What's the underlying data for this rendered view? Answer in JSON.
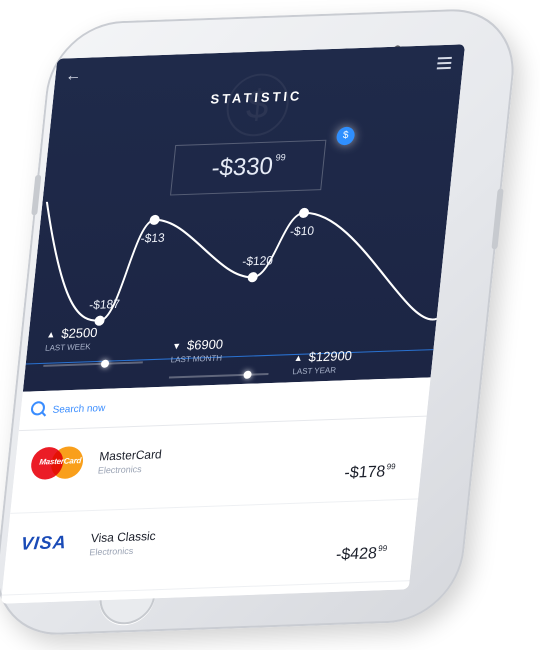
{
  "header": {
    "title": "STATISTIC",
    "back_icon": "arrow-left-icon",
    "menu_icon": "menu-icon"
  },
  "total": {
    "amount": "-$330",
    "cents": "99",
    "badge_icon": "dollar-icon",
    "badge_text": "$"
  },
  "chart_data": {
    "type": "line",
    "points": [
      {
        "label": "-$187",
        "value": -187
      },
      {
        "label": "-$13",
        "value": -13
      },
      {
        "label": "-$120",
        "value": -120
      },
      {
        "label": "-$10",
        "value": -10
      }
    ],
    "colors": {
      "line": "#ffffff",
      "background": "#1f2a4a"
    }
  },
  "periods": [
    {
      "amount": "$2500",
      "caption": "LAST WEEK",
      "direction": "up",
      "arrow": "▲",
      "fill": 0.58
    },
    {
      "amount": "$6900",
      "caption": "LAST MONTH",
      "direction": "down",
      "arrow": "▼",
      "fill": 0.75
    },
    {
      "amount": "$12900",
      "caption": "LAST YEAR",
      "direction": "up",
      "arrow": "▲",
      "fill": 0.92
    }
  ],
  "search": {
    "placeholder": "Search now"
  },
  "transactions": [
    {
      "name": "MasterCard",
      "category": "Electronics",
      "amount": "-$178",
      "cents": "99",
      "logo": "mastercard-logo",
      "logo_text": "MasterCard"
    },
    {
      "name": "Visa Classic",
      "category": "Electronics",
      "amount": "-$428",
      "cents": "99",
      "logo": "visa-logo",
      "logo_text": "VISA"
    }
  ],
  "colors": {
    "accent": "#2f8fff",
    "panel": "#1f2a4a"
  }
}
